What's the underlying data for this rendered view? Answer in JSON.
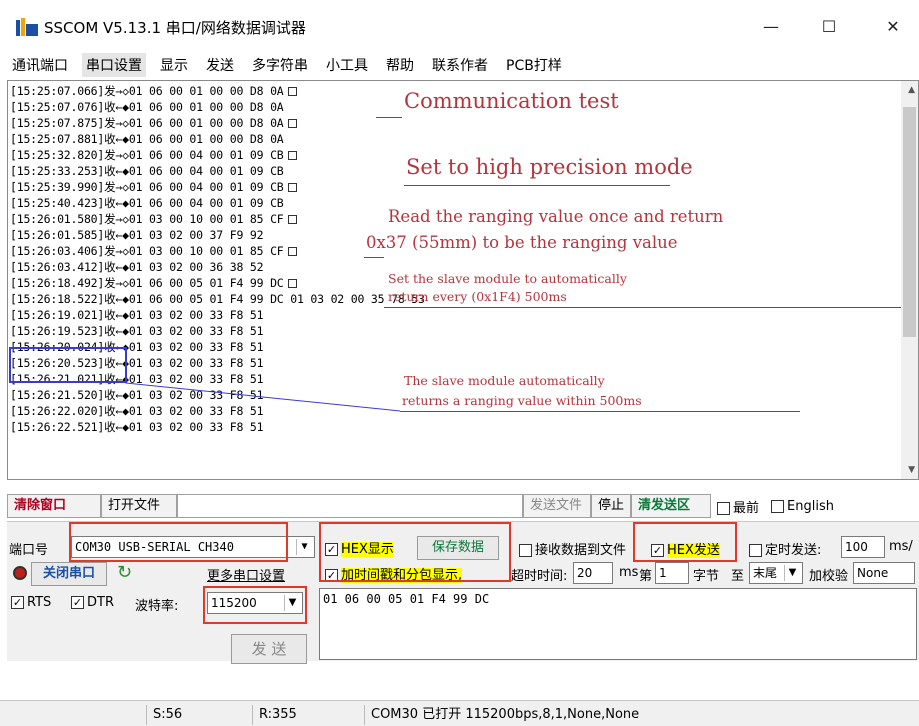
{
  "window": {
    "title": "SSCOM V5.13.1 串口/网络数据调试器",
    "minimize": "—",
    "maximize": "☐",
    "close": "✕"
  },
  "menu": [
    "通讯端口",
    "串口设置",
    "显示",
    "发送",
    "多字符串",
    "小工具",
    "帮助",
    "联系作者",
    "PCB打样"
  ],
  "log": [
    "[15:25:07.066]发→◇01 06 00 01 00 00 D8 0A",
    "[15:25:07.076]收←◆01 06 00 01 00 00 D8 0A",
    "[15:25:07.875]发→◇01 06 00 01 00 00 D8 0A",
    "[15:25:07.881]收←◆01 06 00 01 00 00 D8 0A",
    "[15:25:32.820]发→◇01 06 00 04 00 01 09 CB",
    "[15:25:33.253]收←◆01 06 00 04 00 01 09 CB",
    "[15:25:39.990]发→◇01 06 00 04 00 01 09 CB",
    "[15:25:40.423]收←◆01 06 00 04 00 01 09 CB",
    "[15:26:01.580]发→◇01 03 00 10 00 01 85 CF",
    "[15:26:01.585]收←◆01 03 02 00 37 F9 92",
    "[15:26:03.406]发→◇01 03 00 10 00 01 85 CF",
    "[15:26:03.412]收←◆01 03 02 00 36 38 52",
    "[15:26:18.492]发→◇01 06 00 05 01 F4 99 DC",
    "[15:26:18.522]收←◆01 06 00 05 01 F4 99 DC 01 03 02 00 35 78 53",
    "[15:26:19.021]收←◆01 03 02 00 33 F8 51",
    "[15:26:19.523]收←◆01 03 02 00 33 F8 51",
    "[15:26:20.024]收←◆01 03 02 00 33 F8 51",
    "[15:26:20.523]收←◆01 03 02 00 33 F8 51",
    "[15:26:21.021]收←◆01 03 02 00 33 F8 51",
    "[15:26:21.520]收←◆01 03 02 00 33 F8 51",
    "[15:26:22.020]收←◆01 03 02 00 33 F8 51",
    "[15:26:22.521]收←◆01 03 02 00 33 F8 51"
  ],
  "annotations": {
    "comm_test": "Communication test",
    "high_precision": "Set to high precision mode",
    "read_once_1": "Read the ranging value once and return",
    "read_once_2": "0x37 (55mm) to be the ranging value",
    "auto_1": "Set the slave module to automatically",
    "auto_2": "return every (0x1F4) 500ms",
    "slave_auto_1": "The slave module automatically",
    "slave_auto_2": "returns a ranging value within 500ms"
  },
  "toolbar": {
    "clear_window": "清除窗口",
    "open_file": "打开文件",
    "send_file": "发送文件",
    "stop": "停止",
    "clear_send": "清发送区",
    "front": "最前",
    "english": "English"
  },
  "settings": {
    "port_label": "端口号",
    "port_value": "COM30 USB-SERIAL CH340",
    "hex_display": "HEX显示",
    "save_data": "保存数据",
    "recv_to_file": "接收数据到文件",
    "hex_send": "HEX发送",
    "timed_send": "定时发送:",
    "interval_value": "100",
    "interval_unit": "ms/",
    "close_port": "关闭串口",
    "more_settings": "更多串口设置",
    "timestamp": "加时间戳和分包显示,",
    "timeout_label": "超时时间:",
    "timeout_value": "20",
    "ms": "ms",
    "byte_label_1": "第",
    "byte_value": "1",
    "byte_label_2": "字节",
    "to": "至",
    "end_value": "末尾",
    "checksum_label": "加校验",
    "checksum_value": "None",
    "rts": "RTS",
    "dtr": "DTR",
    "baud_label": "波特率:",
    "baud_value": "115200",
    "send_data": "01 06 00 05 01 F4 99 DC",
    "send_button": "发  送"
  },
  "status": {
    "sent": "S:56",
    "received": "R:355",
    "port_status": "COM30 已打开  115200bps,8,1,None,None"
  },
  "colors": {
    "annotation_red": "#b5343c",
    "highlight_box": "#e0392b",
    "selection_blue": "#3a3ad0"
  }
}
